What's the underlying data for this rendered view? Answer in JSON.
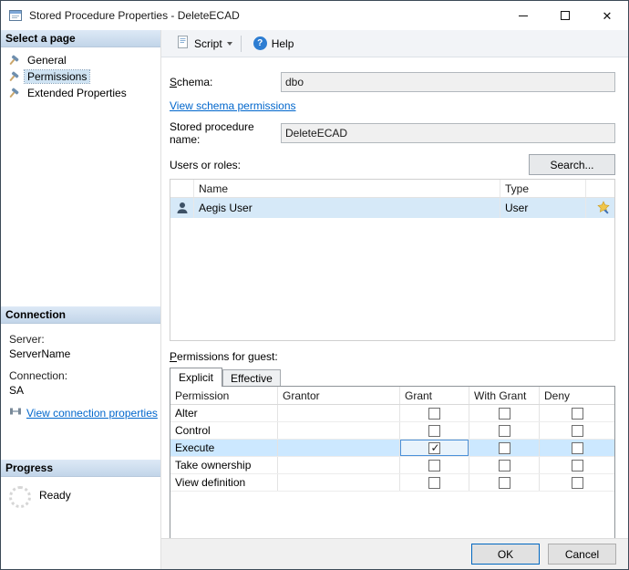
{
  "window": {
    "title": "Stored Procedure Properties - DeleteECAD",
    "close_glyph": "✕"
  },
  "sidebar": {
    "select_page": {
      "header": "Select a page",
      "items": [
        {
          "label": "General",
          "selected": false
        },
        {
          "label": "Permissions",
          "selected": true
        },
        {
          "label": "Extended Properties",
          "selected": false
        }
      ]
    },
    "connection": {
      "header": "Connection",
      "server_label": "Server:",
      "server_value": "ServerName",
      "connection_label": "Connection:",
      "connection_value": "SA",
      "view_link": "View connection properties"
    },
    "progress": {
      "header": "Progress",
      "status": "Ready"
    }
  },
  "toolbar": {
    "script": "Script",
    "help": "Help",
    "help_glyph": "?"
  },
  "form": {
    "schema": {
      "label_accel": "S",
      "label_rest": "chema:",
      "value": "dbo"
    },
    "schema_link": "View schema permissions",
    "procedure_name": {
      "label": "Stored procedure name:",
      "value": "DeleteECAD"
    },
    "users": {
      "label": "Users or roles:",
      "search_button": "Search...",
      "columns": [
        "Name",
        "Type"
      ],
      "rows": [
        {
          "name": "Aegis User",
          "type": "User",
          "selected": true
        }
      ]
    },
    "permissions": {
      "label_accel": "P",
      "label_rest": "ermissions for guest:",
      "tabs": [
        {
          "label": "Explicit",
          "active": true
        },
        {
          "label": "Effective",
          "active": false
        }
      ],
      "columns": [
        "Permission",
        "Grantor",
        "Grant",
        "With Grant",
        "Deny"
      ],
      "rows": [
        {
          "permission": "Alter",
          "grantor": "",
          "grant": false,
          "with_grant": false,
          "deny": false,
          "highlighted": false
        },
        {
          "permission": "Control",
          "grantor": "",
          "grant": false,
          "with_grant": false,
          "deny": false,
          "highlighted": false
        },
        {
          "permission": "Execute",
          "grantor": "",
          "grant": true,
          "with_grant": false,
          "deny": false,
          "highlighted": true,
          "grant_focused": true
        },
        {
          "permission": "Take ownership",
          "grantor": "",
          "grant": false,
          "with_grant": false,
          "deny": false,
          "highlighted": false
        },
        {
          "permission": "View definition",
          "grantor": "",
          "grant": false,
          "with_grant": false,
          "deny": false,
          "highlighted": false
        }
      ]
    }
  },
  "footer": {
    "ok": "OK",
    "cancel": "Cancel"
  }
}
